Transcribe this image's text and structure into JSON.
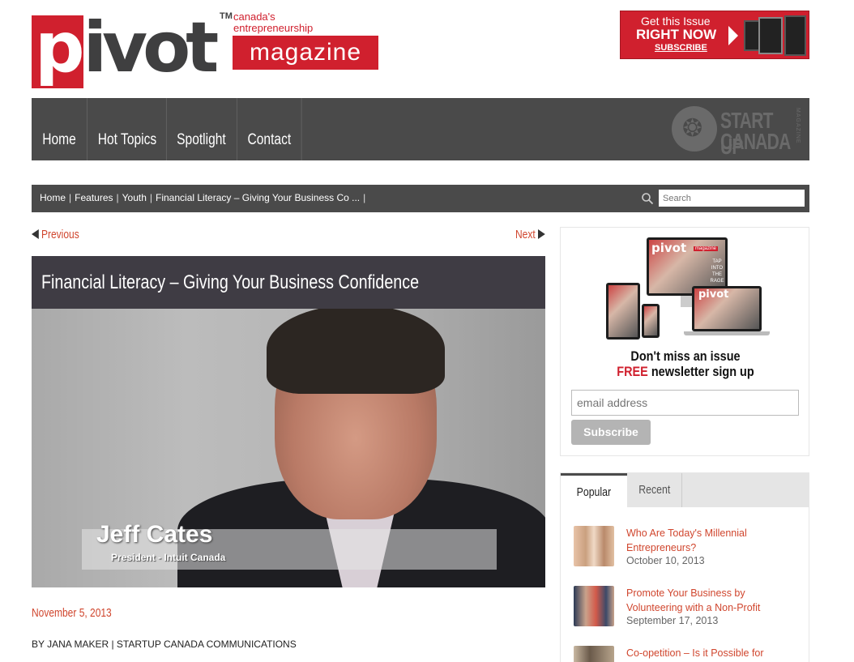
{
  "header": {
    "logo": {
      "word": "pivot",
      "tm": "TM",
      "tagline_1": "canada's",
      "tagline_2": "entrepreneurship",
      "mag": "magazine"
    },
    "promo": {
      "line1": "Get this Issue",
      "line2": "RIGHT NOW",
      "line3": "SUBSCRIBE"
    }
  },
  "nav": {
    "items": [
      {
        "label": "Home"
      },
      {
        "label": "Hot Topics"
      },
      {
        "label": "Spotlight"
      },
      {
        "label": "Contact"
      }
    ],
    "brand": {
      "line1": "START UP",
      "line2": "CANADA",
      "side": "MAGAZINE"
    }
  },
  "breadcrumb": {
    "items": [
      "Home",
      "Features",
      "Youth",
      "Financial Literacy – Giving Your Business Co ..."
    ],
    "separator": "|"
  },
  "search": {
    "placeholder": "Search"
  },
  "pager": {
    "prev": "Previous",
    "next": "Next"
  },
  "article": {
    "title": "Financial Literacy – Giving Your Business Confidence",
    "video": {
      "name": "Jeff Cates",
      "role": "President - Intuit Canada"
    },
    "date": "November 5, 2013",
    "byline": "BY JANA MAKER | STARTUP CANADA COMMUNICATIONS"
  },
  "newsletter": {
    "headline": "Don't miss an issue",
    "free": "FREE",
    "subline": "newsletter sign up",
    "email_placeholder": "email address",
    "button": "Subscribe",
    "device_text": {
      "logo": "pivot",
      "mag": "magazine",
      "tag": "TAP INTO THE RAGE"
    }
  },
  "tabs": {
    "items": [
      {
        "label": "Popular"
      },
      {
        "label": "Recent"
      }
    ],
    "active": "Popular",
    "posts": [
      {
        "title": "Who Are Today's Millennial Entrepreneurs?",
        "date": "October 10, 2013"
      },
      {
        "title": "Promote Your Business by Volunteering with a Non-Profit",
        "date": "September 17, 2013"
      },
      {
        "title": "Co-opetition – Is it Possible for",
        "date": ""
      }
    ]
  },
  "colors": {
    "brand_red": "#d0202e",
    "link_orange": "#d0462e",
    "nav_gray": "#4a4a4a"
  }
}
